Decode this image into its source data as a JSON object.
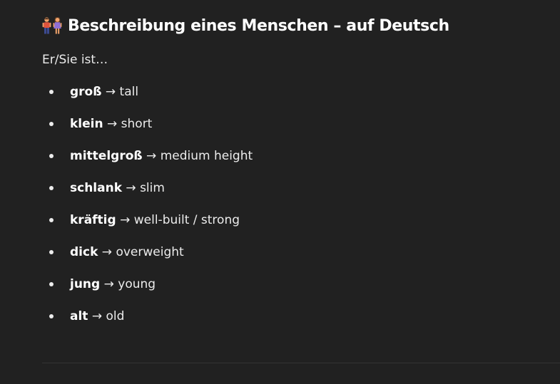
{
  "heading": {
    "icon": "man-and-woman-icon",
    "title": "Beschreibung eines Menschen – auf Deutsch"
  },
  "intro": "Er/Sie ist…",
  "items": [
    {
      "term": "groß",
      "arrow": " → ",
      "translation": "tall"
    },
    {
      "term": "klein",
      "arrow": " → ",
      "translation": "short"
    },
    {
      "term": "mittelgroß",
      "arrow": " → ",
      "translation": "medium height"
    },
    {
      "term": "schlank",
      "arrow": " → ",
      "translation": "slim"
    },
    {
      "term": "kräftig",
      "arrow": " → ",
      "translation": "well-built / strong"
    },
    {
      "term": "dick",
      "arrow": " → ",
      "translation": "overweight"
    },
    {
      "term": "jung",
      "arrow": " → ",
      "translation": "young"
    },
    {
      "term": "alt",
      "arrow": " → ",
      "translation": "old"
    }
  ],
  "colors": {
    "background": "#212121",
    "text": "#ececec",
    "divider": "#343434"
  }
}
